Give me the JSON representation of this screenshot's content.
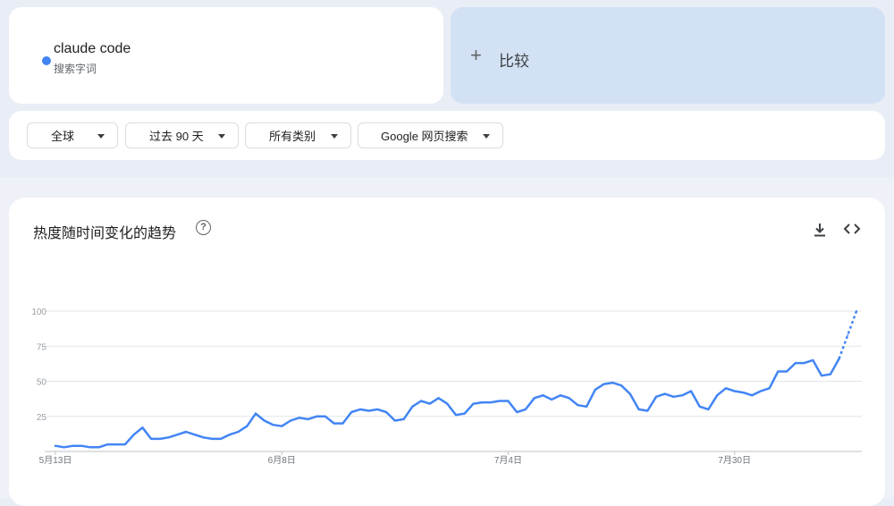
{
  "search_term": {
    "name": "claude code",
    "type": "搜索字词",
    "color": "#4285f4"
  },
  "compare": {
    "icon": "plus-icon",
    "label": "比较"
  },
  "filters": {
    "region": "全球",
    "time": "过去 90 天",
    "category": "所有类别",
    "source": "Google 网页搜索"
  },
  "chart_card": {
    "title": "热度随时间变化的趋势",
    "help_icon": "help-icon",
    "download_icon": "download-icon",
    "embed_icon": "embed-icon"
  },
  "chart_data": {
    "type": "line",
    "title": "热度随时间变化的趋势",
    "x_tick_labels": [
      "5月13日",
      "6月8日",
      "7月4日",
      "7月30日"
    ],
    "x_tick_day_index": [
      0,
      26,
      52,
      78
    ],
    "ylim": [
      0,
      100
    ],
    "y_ticks": [
      25,
      50,
      75,
      100
    ],
    "grid": true,
    "series": [
      {
        "color": "#4285f4",
        "values": [
          4,
          3,
          4,
          4,
          3,
          3,
          5,
          5,
          5,
          12,
          17,
          9,
          9,
          10,
          12,
          14,
          12,
          10,
          9,
          9,
          12,
          14,
          18,
          27,
          22,
          19,
          18,
          22,
          24,
          23,
          25,
          25,
          20,
          20,
          28,
          30,
          29,
          30,
          28,
          22,
          23,
          32,
          36,
          34,
          38,
          34,
          26,
          27,
          34,
          35,
          35,
          36,
          36,
          28,
          30,
          38,
          40,
          37,
          40,
          38,
          33,
          32,
          44,
          48,
          49,
          47,
          41,
          30,
          29,
          39,
          41,
          39,
          40,
          43,
          32,
          30,
          40,
          45,
          43,
          42,
          40,
          43,
          45,
          57,
          57,
          63,
          63,
          65,
          54,
          55,
          66,
          83,
          100
        ],
        "partial_from_index": 90
      }
    ]
  }
}
